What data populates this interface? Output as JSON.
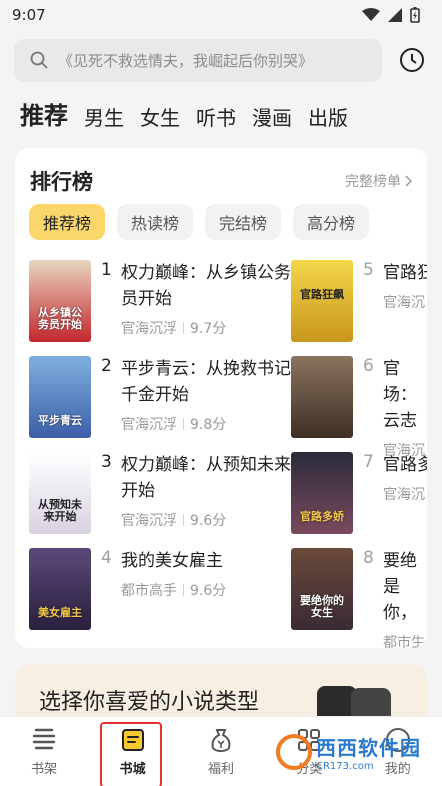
{
  "status": {
    "time": "9:07"
  },
  "search": {
    "placeholder": "《见死不救选情夫，我崛起后你别哭》"
  },
  "nav_tabs": [
    "推荐",
    "男生",
    "女生",
    "听书",
    "漫画",
    "出版"
  ],
  "ranking": {
    "title": "排行榜",
    "full_list": "完整榜单",
    "filters": [
      "推荐榜",
      "热读榜",
      "完结榜",
      "高分榜"
    ],
    "books": [
      {
        "rank": "1",
        "title": "权力巅峰：从乡镇公务员开始",
        "category": "官海沉浮",
        "score": "9.7分",
        "cover_text": "从乡镇公务员开始",
        "cover_color": "#c2262c"
      },
      {
        "rank": "2",
        "title": "平步青云：从挽救书记千金开始",
        "category": "官海沉浮",
        "score": "9.8分",
        "cover_text": "平步青云",
        "cover_color": "#3c5fa8"
      },
      {
        "rank": "3",
        "title": "权力巅峰：从预知未来开始",
        "category": "官海沉浮",
        "score": "9.6分",
        "cover_text": "从预知未来开始",
        "cover_color": "#e7e4ea"
      },
      {
        "rank": "4",
        "title": "我的美女雇主",
        "category": "都市高手",
        "score": "9.6分",
        "cover_text": "美女雇主",
        "cover_color": "#2a1f3c"
      },
      {
        "rank": "5",
        "title": "官路狂",
        "category": "官海沉",
        "score": "",
        "cover_text": "官路狂飙",
        "cover_color": "#e8c52a"
      },
      {
        "rank": "6",
        "title": "官场：云志",
        "category": "官海沉",
        "score": "",
        "cover_text": "",
        "cover_color": "#5a4636"
      },
      {
        "rank": "7",
        "title": "官路多",
        "category": "官海沉",
        "score": "",
        "cover_text": "官路多娇",
        "cover_color": "#7a4a5e"
      },
      {
        "rank": "8",
        "title": "要绝是你，",
        "category": "都市生",
        "score": "",
        "cover_text": "要绝你的女生",
        "cover_color": "#3a2a34"
      }
    ]
  },
  "promo": {
    "title": "选择你喜爱的小说类型"
  },
  "bottom_nav": [
    "书架",
    "书城",
    "福利",
    "分类",
    "我的"
  ],
  "watermark": {
    "title": "西西软件园",
    "url": "CR173.com"
  },
  "colors": {
    "accent_yellow": "#fbd66b",
    "highlight_red": "#e5322d"
  }
}
